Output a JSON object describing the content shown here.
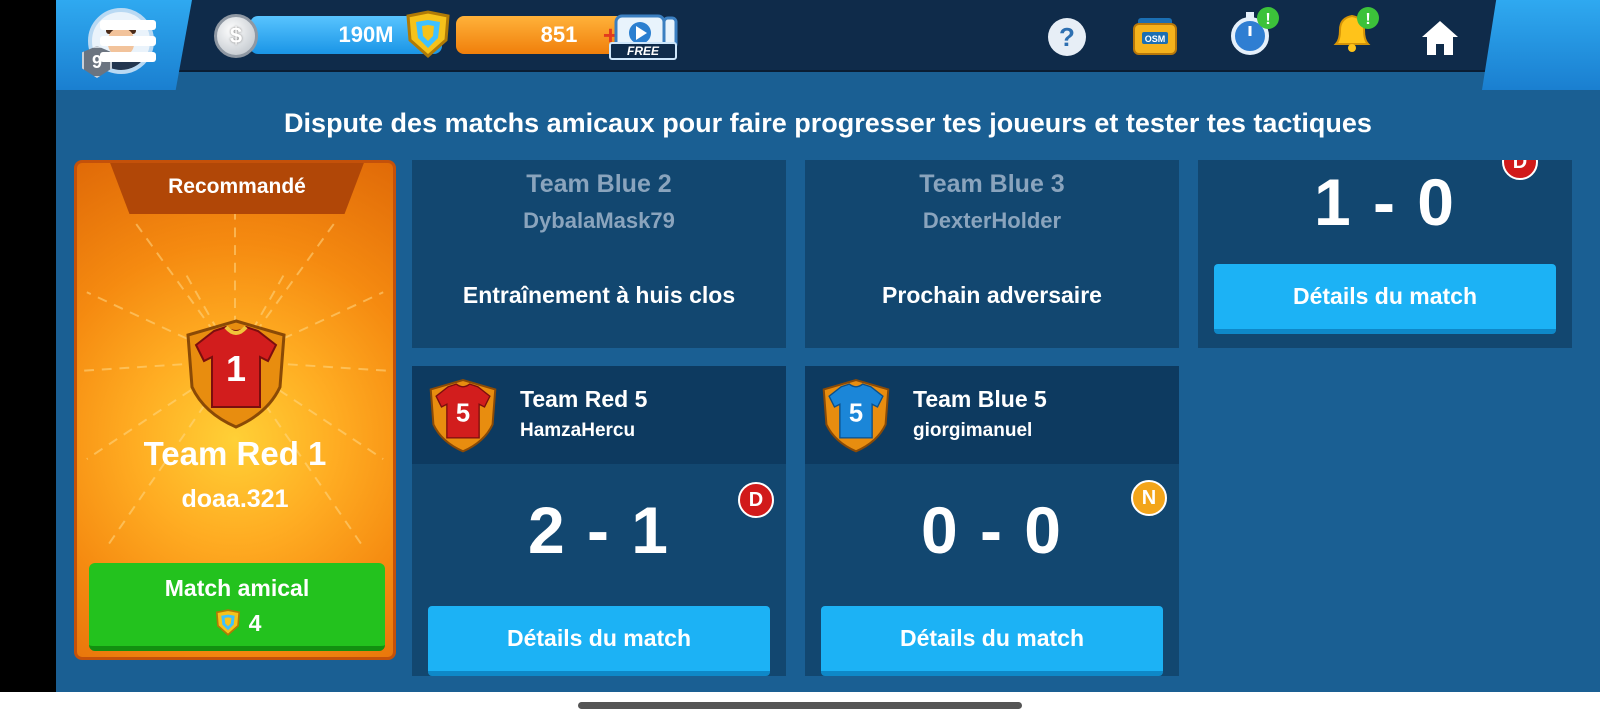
{
  "topbar": {
    "level": "9",
    "coins": "190M",
    "coin_symbol": "$",
    "gems": "851",
    "gem_plus": "+",
    "free_video_label": "FREE",
    "help_symbol": "?",
    "shop_label": "OSM",
    "alert_symbol": "!"
  },
  "subtitle": "Dispute des matchs amicaux pour faire progresser tes joueurs et tester tes tactiques",
  "recommended": {
    "ribbon": "Recommandé",
    "jersey_number": "1",
    "team": "Team Red 1",
    "user": "doaa.321",
    "button_label": "Match amical",
    "button_cost": "4"
  },
  "cards": {
    "blue2": {
      "team": "Team Blue 2",
      "user": "DybalaMask79",
      "state": "Entraînement à huis clos"
    },
    "blue3": {
      "team": "Team Blue 3",
      "user": "DexterHolder",
      "state": "Prochain adversaire"
    },
    "top_right": {
      "badge": "D",
      "score": "1 - 0",
      "details": "Détails du match"
    },
    "red5": {
      "jersey_number": "5",
      "team": "Team Red 5",
      "user": "HamzaHercu",
      "badge": "D",
      "score": "2 - 1",
      "details": "Détails du match"
    },
    "blue5": {
      "jersey_number": "5",
      "team": "Team Blue 5",
      "user": "giorgimanuel",
      "badge": "N",
      "score": "0 - 0",
      "details": "Détails du match"
    }
  },
  "colors": {
    "background": "#1a5f93",
    "topbar": "#0f2b4a",
    "card": "#124770",
    "details_button": "#1cb2f5",
    "friendly_button": "#23c21e",
    "recommended_card": "#f58a10",
    "badge_defeat": "#d11a1a",
    "badge_draw": "#f3a51a"
  },
  "icons": [
    "avatar",
    "silver-coin-icon",
    "gem-icon",
    "free-video-icon",
    "help-icon",
    "osm-shop-icon",
    "stopwatch-icon",
    "bell-icon",
    "home-icon",
    "menu-icon",
    "jersey-icon"
  ]
}
